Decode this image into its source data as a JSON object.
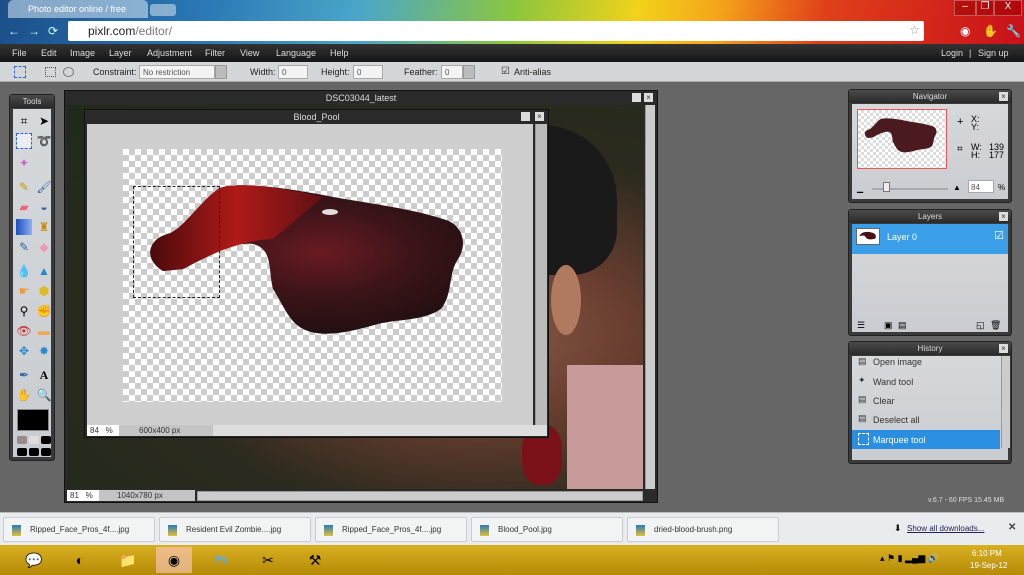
{
  "browser": {
    "tab_title": "Photo editor online / free",
    "url_host": "pixlr.com",
    "url_path": "/editor/",
    "controls": {
      "minimize": "–",
      "restore": "❐",
      "close": "X"
    }
  },
  "menu": {
    "items": [
      "File",
      "Edit",
      "Image",
      "Layer",
      "Adjustment",
      "Filter",
      "View",
      "Language",
      "Help"
    ],
    "login": "Login",
    "separator": "|",
    "signup": "Sign up"
  },
  "options": {
    "constraint_label": "Constraint:",
    "constraint_value": "No restriction",
    "width_label": "Width:",
    "width_value": "0",
    "height_label": "Height:",
    "height_value": "0",
    "feather_label": "Feather:",
    "feather_value": "0",
    "antialias_label": "Anti-alias",
    "antialias_checked": true
  },
  "tools": {
    "title": "Tools",
    "primary_color": "#000000"
  },
  "doc_main": {
    "title": "DSC03044_latest",
    "zoom": "81",
    "zoom_unit": "%",
    "size": "1040x780 px"
  },
  "doc_blood": {
    "title": "Blood_Pool",
    "zoom": "84",
    "zoom_unit": "%",
    "size": "600x400 px"
  },
  "navigator": {
    "title": "Navigator",
    "x_label": "X:",
    "y_label": "Y:",
    "w_label": "W:",
    "w_value": "139",
    "h_label": "H:",
    "h_value": "177",
    "zoom": "84",
    "zoom_unit": "%"
  },
  "layers": {
    "title": "Layers",
    "items": [
      {
        "name": "Layer 0",
        "visible": true,
        "selected": true
      }
    ]
  },
  "history": {
    "title": "History",
    "items": [
      "Open image",
      "Wand tool",
      "Clear",
      "Deselect all",
      "Marquee tool"
    ],
    "selected": "Marquee tool"
  },
  "version": "v.6.7 - 60 FPS 15.45 MB",
  "downloads": {
    "items": [
      "Ripped_Face_Pros_4f....jpg",
      "Resident Evil Zombie....jpg",
      "Ripped_Face_Pros_4f....jpg",
      "Blood_Pool.jpg",
      "dried-blood-brush.png"
    ],
    "show_all": "Show all downloads...",
    "close": "✕"
  },
  "taskbar": {
    "apps": [
      "talk",
      "picasa",
      "explorer",
      "chrome",
      "photoshop",
      "snipping",
      "tool"
    ],
    "time": "6:10 PM",
    "date": "19-Sep-12"
  },
  "colors": {
    "accent": "#3a9ee8",
    "selection": "#2a8fe0"
  }
}
